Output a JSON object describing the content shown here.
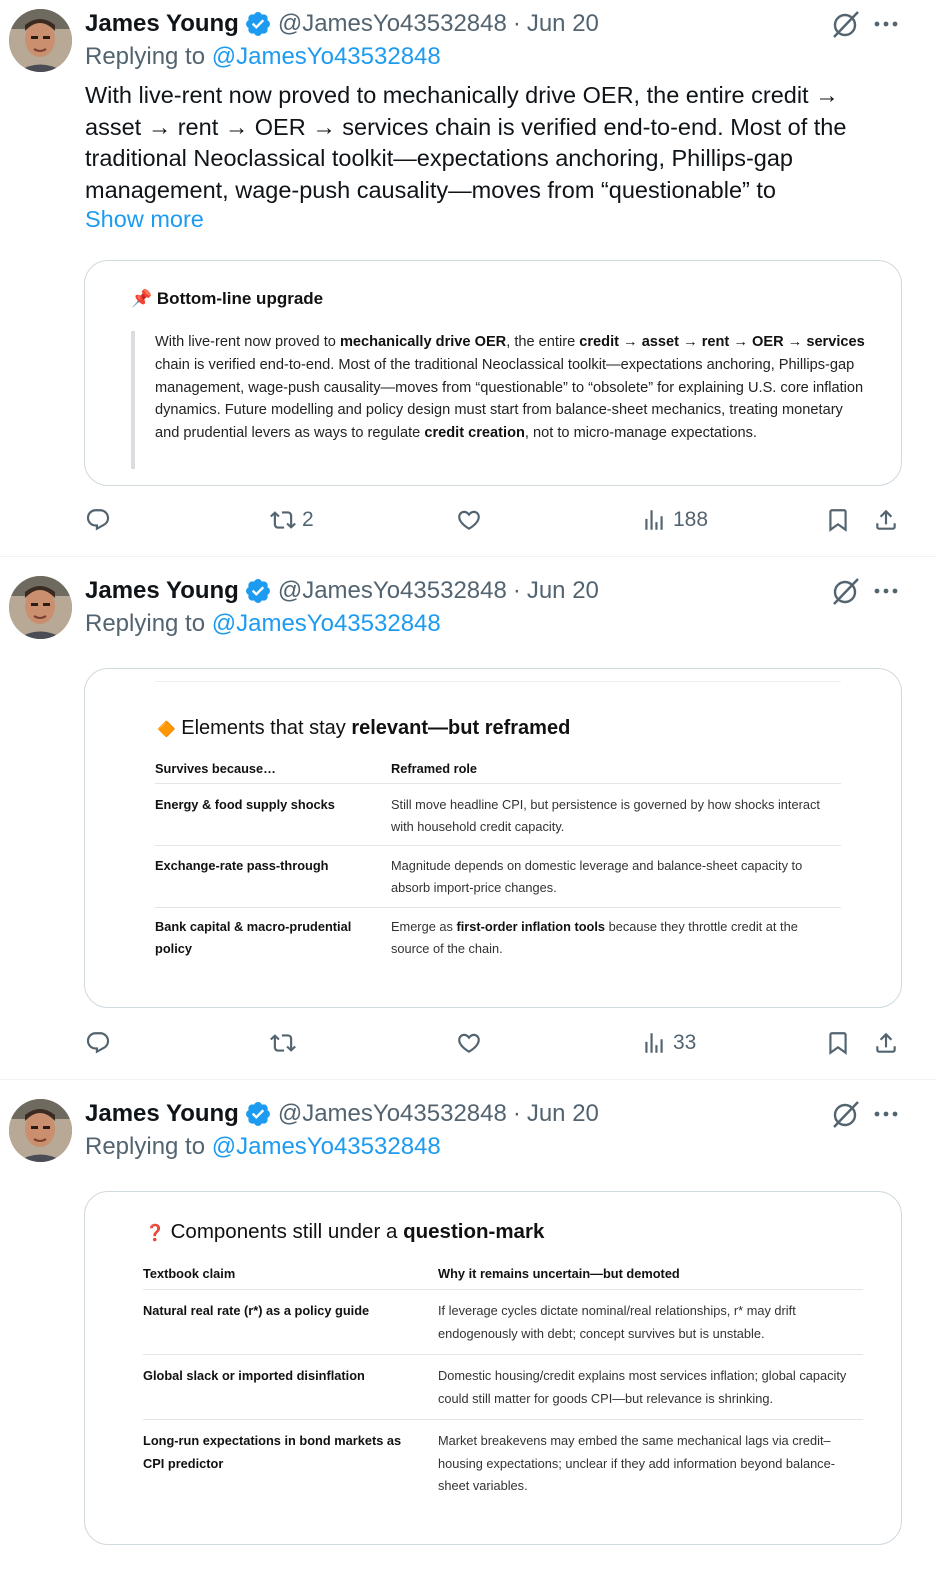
{
  "tweets": [
    {
      "author": {
        "name": "James Young",
        "handle": "@JamesYo43532848"
      },
      "date": "Jun 20",
      "replying_prefix": "Replying to ",
      "replying_to": "@JamesYo43532848",
      "text": "With live-rent now proved to mechanically drive OER, the entire credit → asset → rent → OER → services chain is verified end-to-end. Most of the traditional Neoclassical toolkit—expectations anchoring, Phillips-gap management, wage-push causality—moves from “questionable” to",
      "show_more": "Show more",
      "card": {
        "emoji": "📌",
        "heading": "Bottom-line upgrade",
        "segments": [
          {
            "t": "With live-rent now proved to ",
            "b": false
          },
          {
            "t": "mechanically drive OER",
            "b": true
          },
          {
            "t": ", the entire ",
            "b": false
          },
          {
            "t": "credit → asset → rent → OER → services",
            "b": true
          },
          {
            "t": " chain is verified end-to-end. Most of the traditional Neoclassical toolkit—expectations anchoring, Phillips-gap management, wage-push causality—moves from “questionable” to “obsolete” for explaining U.S. core inflation dynamics. Future modelling and policy design must start from balance-sheet mechanics, treating monetary and prudential levers as ways to regulate ",
            "b": false
          },
          {
            "t": "credit creation",
            "b": true
          },
          {
            "t": ", not to micro-manage expectations.",
            "b": false
          }
        ]
      },
      "stats": {
        "replies": "",
        "reposts": "2",
        "likes": "",
        "views": "188"
      }
    },
    {
      "author": {
        "name": "James Young",
        "handle": "@JamesYo43532848"
      },
      "date": "Jun 20",
      "replying_prefix": "Replying to ",
      "replying_to": "@JamesYo43532848",
      "card": {
        "emoji": "🔶",
        "heading_plain": "Elements that stay ",
        "heading_bold": "relevant—but reframed",
        "columns": [
          "Survives because…",
          "Reframed role"
        ],
        "rows": [
          {
            "c1": "Energy & food supply shocks",
            "c2": [
              {
                "t": "Still move headline CPI, but persistence is governed by how shocks interact with household credit capacity.",
                "b": false
              }
            ]
          },
          {
            "c1": "Exchange-rate pass-through",
            "c2": [
              {
                "t": "Magnitude depends on domestic leverage and balance-sheet capacity to absorb import-price changes.",
                "b": false
              }
            ]
          },
          {
            "c1": "Bank capital & macro-prudential policy",
            "c2": [
              {
                "t": "Emerge as ",
                "b": false
              },
              {
                "t": "first-order inflation tools",
                "b": true
              },
              {
                "t": " because they throttle credit at the source of the chain.",
                "b": false
              }
            ]
          }
        ]
      },
      "stats": {
        "replies": "",
        "reposts": "",
        "likes": "",
        "views": "33"
      }
    },
    {
      "author": {
        "name": "James Young",
        "handle": "@JamesYo43532848"
      },
      "date": "Jun 20",
      "replying_prefix": "Replying to ",
      "replying_to": "@JamesYo43532848",
      "card": {
        "emoji": "❓",
        "heading_plain": "Components still under a ",
        "heading_bold": "question-mark",
        "columns": [
          "Textbook claim",
          "Why it remains uncertain—but demoted"
        ],
        "rows": [
          {
            "c1": "Natural real rate (r*) as a policy guide",
            "c2": [
              {
                "t": "If leverage cycles dictate nominal/real relationships, r* may drift endogenously with debt; concept survives but is unstable.",
                "b": false
              }
            ]
          },
          {
            "c1": "Global slack or imported disinflation",
            "c2": [
              {
                "t": "Domestic housing/credit explains most services inflation; global capacity could still matter for goods CPI—but relevance is shrinking.",
                "b": false
              }
            ]
          },
          {
            "c1": "Long-run expectations in bond markets as CPI predictor",
            "c2": [
              {
                "t": "Market breakevens may embed the same mechanical lags via credit–housing expectations; unclear if they add information beyond balance-sheet variables.",
                "b": false
              }
            ]
          }
        ]
      }
    }
  ],
  "colors": {
    "accent": "#1d9bf0",
    "muted": "#536471",
    "text": "#0f1419",
    "border": "#cfd9de"
  },
  "icons": [
    "verified-badge-icon",
    "grok-icon",
    "more-icon",
    "reply-icon",
    "repost-icon",
    "like-icon",
    "views-icon",
    "bookmark-icon",
    "share-icon"
  ]
}
